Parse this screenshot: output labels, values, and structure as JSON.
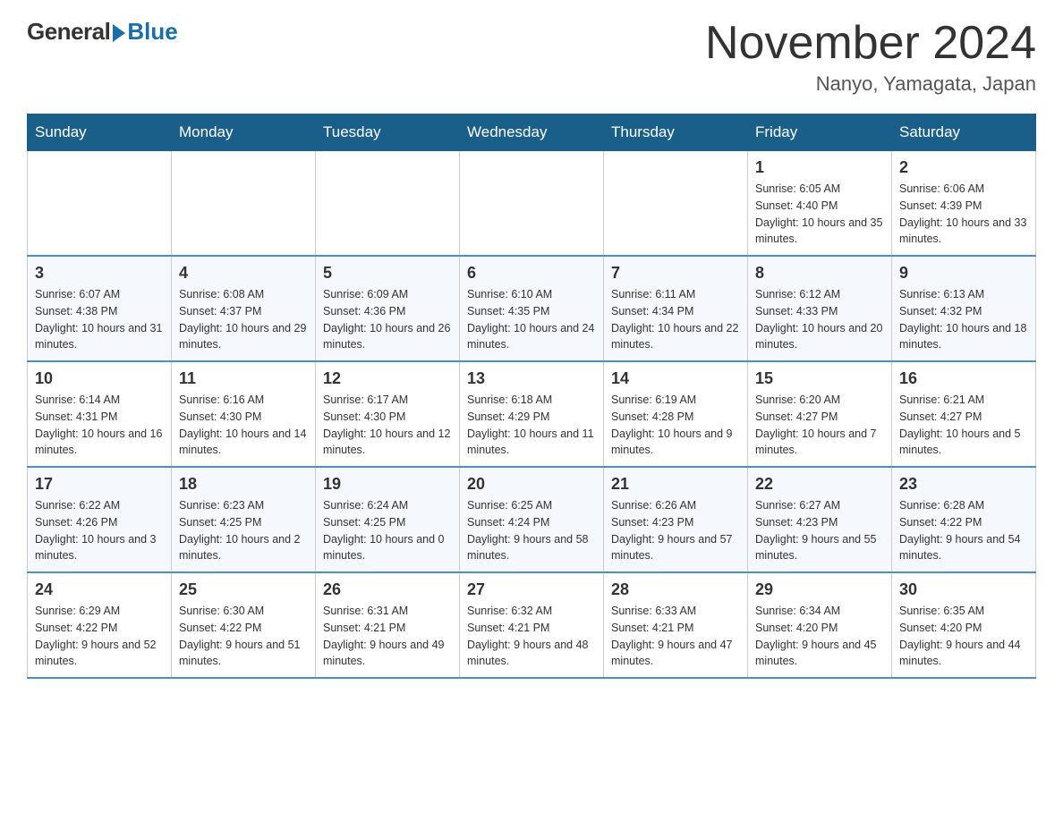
{
  "header": {
    "logo_general": "General",
    "logo_blue": "Blue",
    "month_title": "November 2024",
    "location": "Nanyo, Yamagata, Japan"
  },
  "days_of_week": [
    "Sunday",
    "Monday",
    "Tuesday",
    "Wednesday",
    "Thursday",
    "Friday",
    "Saturday"
  ],
  "weeks": [
    [
      {
        "day": "",
        "info": ""
      },
      {
        "day": "",
        "info": ""
      },
      {
        "day": "",
        "info": ""
      },
      {
        "day": "",
        "info": ""
      },
      {
        "day": "",
        "info": ""
      },
      {
        "day": "1",
        "info": "Sunrise: 6:05 AM\nSunset: 4:40 PM\nDaylight: 10 hours and 35 minutes."
      },
      {
        "day": "2",
        "info": "Sunrise: 6:06 AM\nSunset: 4:39 PM\nDaylight: 10 hours and 33 minutes."
      }
    ],
    [
      {
        "day": "3",
        "info": "Sunrise: 6:07 AM\nSunset: 4:38 PM\nDaylight: 10 hours and 31 minutes."
      },
      {
        "day": "4",
        "info": "Sunrise: 6:08 AM\nSunset: 4:37 PM\nDaylight: 10 hours and 29 minutes."
      },
      {
        "day": "5",
        "info": "Sunrise: 6:09 AM\nSunset: 4:36 PM\nDaylight: 10 hours and 26 minutes."
      },
      {
        "day": "6",
        "info": "Sunrise: 6:10 AM\nSunset: 4:35 PM\nDaylight: 10 hours and 24 minutes."
      },
      {
        "day": "7",
        "info": "Sunrise: 6:11 AM\nSunset: 4:34 PM\nDaylight: 10 hours and 22 minutes."
      },
      {
        "day": "8",
        "info": "Sunrise: 6:12 AM\nSunset: 4:33 PM\nDaylight: 10 hours and 20 minutes."
      },
      {
        "day": "9",
        "info": "Sunrise: 6:13 AM\nSunset: 4:32 PM\nDaylight: 10 hours and 18 minutes."
      }
    ],
    [
      {
        "day": "10",
        "info": "Sunrise: 6:14 AM\nSunset: 4:31 PM\nDaylight: 10 hours and 16 minutes."
      },
      {
        "day": "11",
        "info": "Sunrise: 6:16 AM\nSunset: 4:30 PM\nDaylight: 10 hours and 14 minutes."
      },
      {
        "day": "12",
        "info": "Sunrise: 6:17 AM\nSunset: 4:30 PM\nDaylight: 10 hours and 12 minutes."
      },
      {
        "day": "13",
        "info": "Sunrise: 6:18 AM\nSunset: 4:29 PM\nDaylight: 10 hours and 11 minutes."
      },
      {
        "day": "14",
        "info": "Sunrise: 6:19 AM\nSunset: 4:28 PM\nDaylight: 10 hours and 9 minutes."
      },
      {
        "day": "15",
        "info": "Sunrise: 6:20 AM\nSunset: 4:27 PM\nDaylight: 10 hours and 7 minutes."
      },
      {
        "day": "16",
        "info": "Sunrise: 6:21 AM\nSunset: 4:27 PM\nDaylight: 10 hours and 5 minutes."
      }
    ],
    [
      {
        "day": "17",
        "info": "Sunrise: 6:22 AM\nSunset: 4:26 PM\nDaylight: 10 hours and 3 minutes."
      },
      {
        "day": "18",
        "info": "Sunrise: 6:23 AM\nSunset: 4:25 PM\nDaylight: 10 hours and 2 minutes."
      },
      {
        "day": "19",
        "info": "Sunrise: 6:24 AM\nSunset: 4:25 PM\nDaylight: 10 hours and 0 minutes."
      },
      {
        "day": "20",
        "info": "Sunrise: 6:25 AM\nSunset: 4:24 PM\nDaylight: 9 hours and 58 minutes."
      },
      {
        "day": "21",
        "info": "Sunrise: 6:26 AM\nSunset: 4:23 PM\nDaylight: 9 hours and 57 minutes."
      },
      {
        "day": "22",
        "info": "Sunrise: 6:27 AM\nSunset: 4:23 PM\nDaylight: 9 hours and 55 minutes."
      },
      {
        "day": "23",
        "info": "Sunrise: 6:28 AM\nSunset: 4:22 PM\nDaylight: 9 hours and 54 minutes."
      }
    ],
    [
      {
        "day": "24",
        "info": "Sunrise: 6:29 AM\nSunset: 4:22 PM\nDaylight: 9 hours and 52 minutes."
      },
      {
        "day": "25",
        "info": "Sunrise: 6:30 AM\nSunset: 4:22 PM\nDaylight: 9 hours and 51 minutes."
      },
      {
        "day": "26",
        "info": "Sunrise: 6:31 AM\nSunset: 4:21 PM\nDaylight: 9 hours and 49 minutes."
      },
      {
        "day": "27",
        "info": "Sunrise: 6:32 AM\nSunset: 4:21 PM\nDaylight: 9 hours and 48 minutes."
      },
      {
        "day": "28",
        "info": "Sunrise: 6:33 AM\nSunset: 4:21 PM\nDaylight: 9 hours and 47 minutes."
      },
      {
        "day": "29",
        "info": "Sunrise: 6:34 AM\nSunset: 4:20 PM\nDaylight: 9 hours and 45 minutes."
      },
      {
        "day": "30",
        "info": "Sunrise: 6:35 AM\nSunset: 4:20 PM\nDaylight: 9 hours and 44 minutes."
      }
    ]
  ]
}
